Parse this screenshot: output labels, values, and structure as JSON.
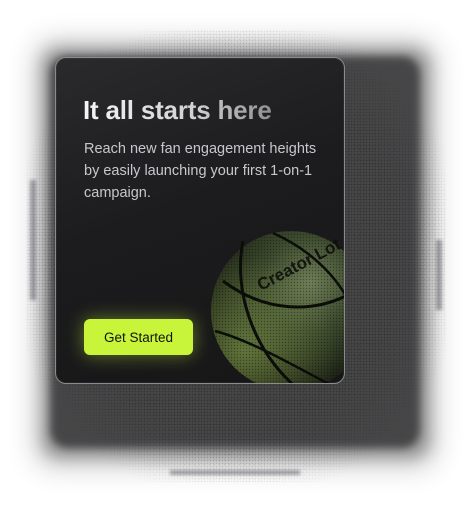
{
  "card": {
    "title": "It all starts here",
    "description": "Reach new fan engagement heights by easily launching your first 1-on-1 campaign.",
    "cta_label": "Get Started",
    "ball_brand_text": "Creator Lot"
  },
  "colors": {
    "card_background": "#1c1c1e",
    "card_border": "#8a8a8f",
    "cta_background": "#c8f53a",
    "cta_text": "#121212",
    "ball_tint": "#4a5a3a"
  },
  "icons": {
    "ball": "basketball-icon"
  }
}
